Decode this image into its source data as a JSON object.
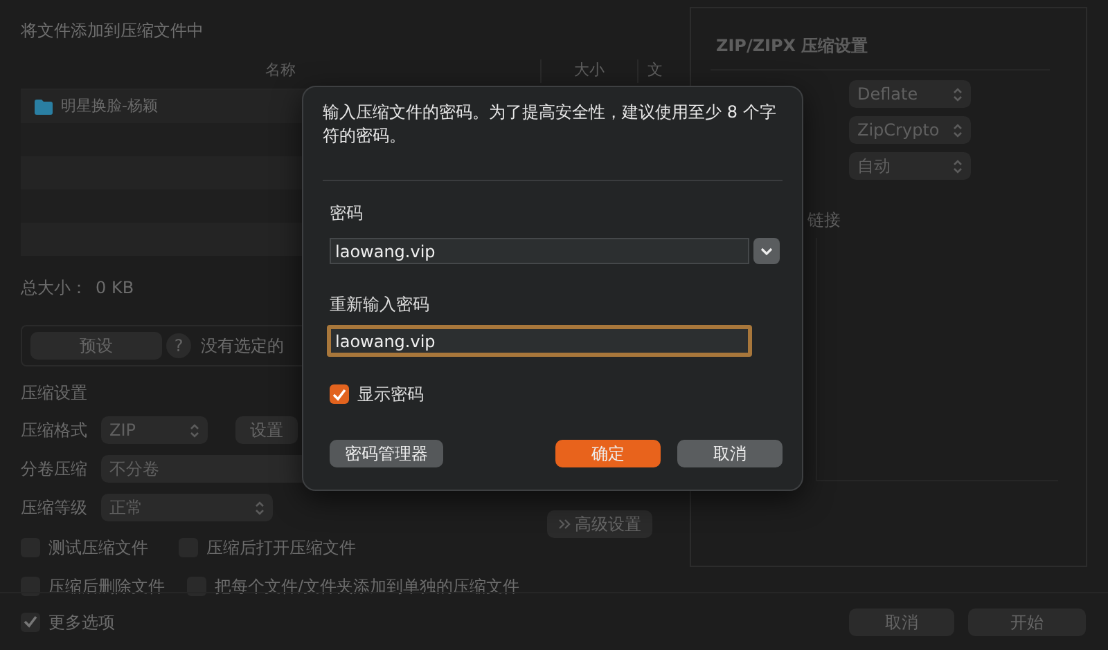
{
  "window": {
    "title": "将文件添加到压缩文件中"
  },
  "file_list": {
    "columns": [
      "名称",
      "大小",
      "文"
    ],
    "rows": [
      {
        "name": "明星换脸-杨颖",
        "kind": "folder"
      }
    ]
  },
  "total_size": {
    "label": "总大小：",
    "value": "0 KB"
  },
  "preset": {
    "button": "预设",
    "help": "?",
    "status": "没有选定的"
  },
  "compression": {
    "heading": "压缩设置",
    "rows": [
      {
        "label": "压缩格式",
        "value": "ZIP",
        "kind": "select",
        "button": "设置"
      },
      {
        "label": "分卷压缩",
        "value": "不分卷",
        "kind": "combo"
      },
      {
        "label": "压缩等级",
        "value": "正常",
        "kind": "select",
        "button": "高级设置"
      }
    ]
  },
  "options": [
    {
      "label": "测试压缩文件",
      "checked": false
    },
    {
      "label": "压缩后打开压缩文件",
      "checked": false
    },
    {
      "label": "压缩后删除文件",
      "checked": false
    },
    {
      "label": "把每个文件/文件夹添加到单独的压缩文件",
      "checked": false
    }
  ],
  "zip_settings": {
    "title": "ZIP/ZIPX 压缩设置",
    "selects": [
      "Deflate",
      "ZipCrypto",
      "自动"
    ],
    "link_text": "链接"
  },
  "more_options": {
    "label": "更多选项",
    "checked": true
  },
  "footer_buttons": [
    "取消",
    "开始"
  ],
  "password_dialog": {
    "message": "输入压缩文件的密码。为了提高安全性，建议使用至少 8 个字符的密码。",
    "password_label": "密码",
    "password_value": "laowang.vip",
    "confirm_label": "重新输入密码",
    "confirm_value": "laowang.vip",
    "show_password": {
      "label": "显示密码",
      "checked": true
    },
    "manager_button": "密码管理器",
    "ok_button": "确定",
    "cancel_button": "取消"
  }
}
